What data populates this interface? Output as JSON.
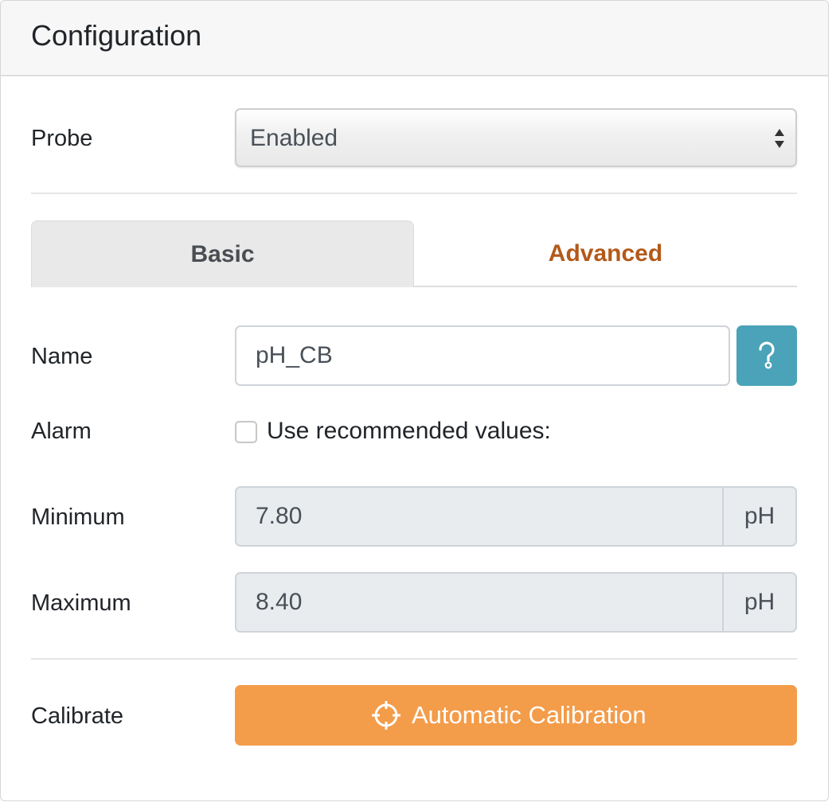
{
  "panel": {
    "title": "Configuration"
  },
  "probe": {
    "label": "Probe",
    "selected": "Enabled"
  },
  "tabs": [
    {
      "label": "Basic",
      "active": false
    },
    {
      "label": "Advanced",
      "active": true
    }
  ],
  "name": {
    "label": "Name",
    "value": "pH_CB",
    "help_icon": "question-icon"
  },
  "alarm": {
    "label": "Alarm",
    "checkbox_label": "Use recommended values:",
    "checked": false
  },
  "minimum": {
    "label": "Minimum",
    "value": "7.80",
    "unit": "pH"
  },
  "maximum": {
    "label": "Maximum",
    "value": "8.40",
    "unit": "pH"
  },
  "calibrate": {
    "label": "Calibrate",
    "button_label": "Automatic Calibration",
    "button_icon": "crosshairs-icon"
  },
  "colors": {
    "accent_tab": "#b3591a",
    "help_button": "#4aa3b8",
    "calibrate_button": "#f39c4a"
  }
}
